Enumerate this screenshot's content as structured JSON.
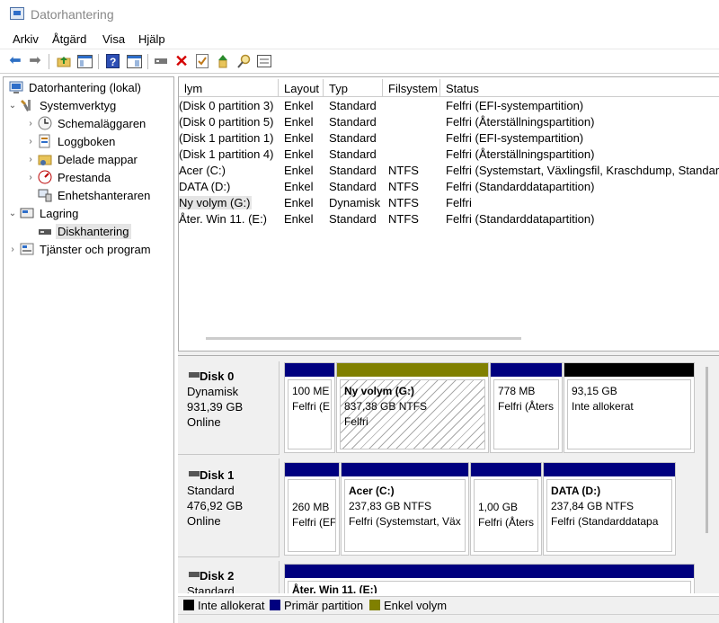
{
  "window": {
    "title": "Datorhantering"
  },
  "menu": [
    "Arkiv",
    "Åtgärd",
    "Visa",
    "Hjälp"
  ],
  "toolbar": {
    "icons": [
      "back-arrow-icon",
      "forward-arrow-icon",
      "up-folder-icon",
      "show-hide-tree-icon",
      "help-icon",
      "action-pane-icon",
      "connect-drive-icon",
      "delete-icon",
      "properties-icon",
      "import-icon",
      "find-icon",
      "rescan-icon"
    ],
    "delete_color": "#d40000"
  },
  "tree": {
    "root": "Datorhantering (lokal)",
    "system_tools": "Systemverktyg",
    "scheduler": "Schemaläggaren",
    "event_viewer": "Loggboken",
    "shared_folders": "Delade mappar",
    "performance": "Prestanda",
    "device_manager": "Enhetshanteraren",
    "storage": "Lagring",
    "disk_management": "Diskhantering",
    "services": "Tjänster och program"
  },
  "volumes": {
    "headers": [
      "lym",
      "Layout",
      "Typ",
      "Filsystem",
      "Status"
    ],
    "rows": [
      [
        "(Disk 0 partition 3)",
        "Enkel",
        "Standard",
        "",
        "Felfri (EFI-systempartition)"
      ],
      [
        "(Disk 0 partition 5)",
        "Enkel",
        "Standard",
        "",
        "Felfri (Återställningspartition)"
      ],
      [
        "(Disk 1 partition 1)",
        "Enkel",
        "Standard",
        "",
        "Felfri (EFI-systempartition)"
      ],
      [
        "(Disk 1 partition 4)",
        "Enkel",
        "Standard",
        "",
        "Felfri (Återställningspartition)"
      ],
      [
        "Acer (C:)",
        "Enkel",
        "Standard",
        "NTFS",
        "Felfri (Systemstart, Växlingsfil, Kraschdump, Standar"
      ],
      [
        "DATA (D:)",
        "Enkel",
        "Standard",
        "NTFS",
        "Felfri (Standarddatapartition)"
      ],
      [
        "Ny volym (G:)",
        "Enkel",
        "Dynamisk",
        "NTFS",
        "Felfri"
      ],
      [
        "Åter. Win 11. (E:)",
        "Enkel",
        "Standard",
        "NTFS",
        "Felfri (Standarddatapartition)"
      ]
    ]
  },
  "disks": [
    {
      "name": "Disk 0",
      "type": "Dynamisk",
      "size": "931,39 GB",
      "state": "Online",
      "partitions": [
        {
          "label": "",
          "size": "100 ME",
          "status": "Felfri (E",
          "bar": "#00007f"
        },
        {
          "label": "Ny volym  (G:)",
          "size": "837,38 GB NTFS",
          "status": "Felfri",
          "bar": "#808000"
        },
        {
          "label": "",
          "size": "778 MB",
          "status": "Felfri (Åters",
          "bar": "#00007f"
        },
        {
          "label": "",
          "size": "93,15 GB",
          "status": "Inte allokerat",
          "bar": "#000000"
        }
      ]
    },
    {
      "name": "Disk 1",
      "type": "Standard",
      "size": "476,92 GB",
      "state": "Online",
      "partitions": [
        {
          "label": "",
          "size": "260 MB",
          "status": "Felfri (EF",
          "bar": "#00007f"
        },
        {
          "label": "Acer  (C:)",
          "size": "237,83 GB NTFS",
          "status": "Felfri (Systemstart, Väx",
          "bar": "#00007f"
        },
        {
          "label": "",
          "size": "1,00 GB",
          "status": "Felfri (Åters",
          "bar": "#00007f"
        },
        {
          "label": "DATA  (D:)",
          "size": "237,84 GB NTFS",
          "status": "Felfri (Standarddatapa",
          "bar": "#00007f"
        }
      ]
    },
    {
      "name": "Disk 2",
      "type": "Standard",
      "partitions": [
        {
          "label": "Åter. Win 11.  (E:)",
          "bar": "#00007f"
        }
      ]
    }
  ],
  "legend": [
    {
      "label": "Inte allokerat",
      "color": "#000000"
    },
    {
      "label": "Primär partition",
      "color": "#00007f"
    },
    {
      "label": "Enkel volym",
      "color": "#808000"
    }
  ]
}
